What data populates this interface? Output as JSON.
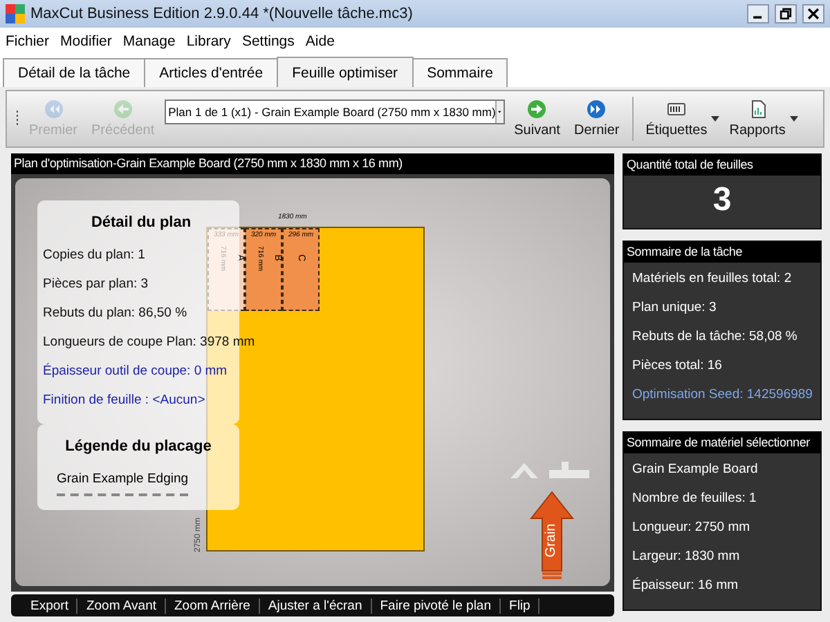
{
  "window": {
    "title": "MaxCut Business Edition 2.9.0.44 *(Nouvelle tâche.mc3)"
  },
  "menu": [
    "Fichier",
    "Modifier",
    "Manage",
    "Library",
    "Settings",
    "Aide"
  ],
  "tabs": [
    {
      "label": "Détail de la tâche",
      "selected": false
    },
    {
      "label": "Articles d'entrée",
      "selected": false
    },
    {
      "label": "Feuille optimiser",
      "selected": true
    },
    {
      "label": "Sommaire",
      "selected": false
    }
  ],
  "toolbar": {
    "left": [
      {
        "label": "Premier",
        "disabled": true,
        "kind": "first"
      },
      {
        "label": "Précédent",
        "disabled": true,
        "kind": "prev"
      }
    ],
    "plan_select": {
      "value": "Plan 1 de 1 (x1) - Grain Example Board (2750 mm x 1830 mm)"
    },
    "right": [
      {
        "label": "Suivant",
        "disabled": false,
        "kind": "next"
      },
      {
        "label": "Dernier",
        "disabled": false,
        "kind": "last"
      }
    ],
    "menus": [
      {
        "label": "Étiquettes",
        "kind": "labels"
      },
      {
        "label": "Rapports",
        "kind": "reports"
      }
    ]
  },
  "plan": {
    "title": "Plan d'optimisation-Grain Example Board (2750 mm x 1830 mm x 16 mm)",
    "detail": {
      "title": "Détail du plan",
      "lines": [
        {
          "text": "Copies du plan: 1",
          "kind": "stat"
        },
        {
          "text": "Pièces par plan: 3",
          "kind": "stat"
        },
        {
          "text": "Rebuts du plan: 86,50 %",
          "kind": "stat"
        },
        {
          "text": "Longueurs de coupe Plan: 3978 mm",
          "kind": "stat"
        },
        {
          "text": "Épaisseur outil de coupe: 0 mm",
          "kind": "setting"
        },
        {
          "text": "Finition de feuille :  <Aucun>",
          "kind": "setting"
        }
      ]
    },
    "legend": {
      "title": "Légende du placage",
      "items": [
        {
          "label": "Grain Example Edging"
        }
      ]
    },
    "board": {
      "width_label": "1830 mm",
      "length_label": "2750 mm",
      "pieces": [
        {
          "label": "A",
          "width": "333 mm",
          "length": "716 mm",
          "faded": true
        },
        {
          "label": "B",
          "width": "320 mm",
          "length": "716 mm",
          "faded": false
        },
        {
          "label": "C",
          "width": "296 mm",
          "faded": false
        }
      ]
    },
    "grain_label": "Grain"
  },
  "actions": [
    "Export",
    "Zoom Avant",
    "Zoom Arrière",
    "Ajuster a l'écran",
    "Faire pivoté le plan",
    "Flip"
  ],
  "total_sheets": {
    "title": "Quantité total de feuilles",
    "value": "3"
  },
  "job_summary": {
    "title": "Sommaire de la tâche",
    "lines": [
      {
        "text": "Matériels en feuilles total: 2",
        "kind": "stat"
      },
      {
        "text": "Plan unique: 3",
        "kind": "stat"
      },
      {
        "text": "Rebuts de la tâche: 58,08 %",
        "kind": "stat"
      },
      {
        "text": "Pièces total: 16",
        "kind": "stat"
      },
      {
        "text": "Optimisation Seed: 142596989",
        "kind": "setting"
      }
    ]
  },
  "material_summary": {
    "title": "Sommaire de matériel sélectionner",
    "lines": [
      {
        "text": "Grain Example Board",
        "kind": "stat"
      },
      {
        "text": "Nombre de feuilles: 1",
        "kind": "stat"
      },
      {
        "text": "Longueur: 2750 mm",
        "kind": "stat"
      },
      {
        "text": "Largeur: 1830 mm",
        "kind": "stat"
      },
      {
        "text": "Épaisseur: 16 mm",
        "kind": "stat"
      }
    ]
  }
}
